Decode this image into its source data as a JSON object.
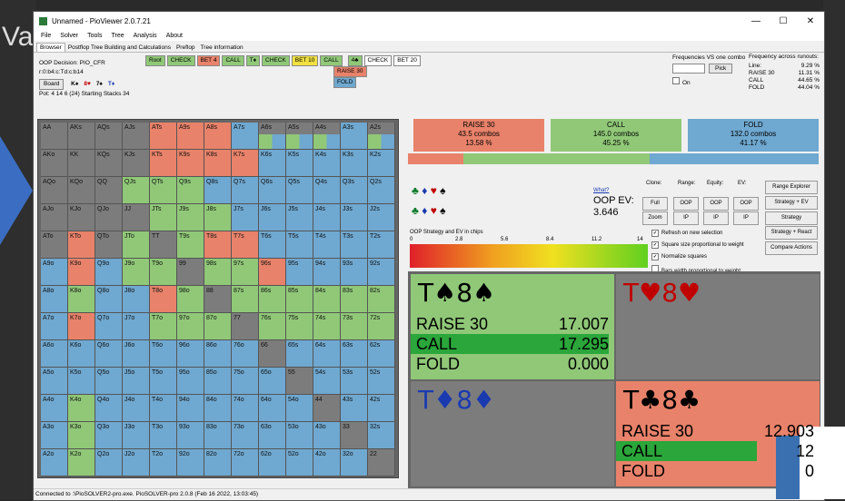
{
  "window": {
    "title": "Unnamed - PioViewer 2.0.7.21"
  },
  "background": {
    "left_text": "Va"
  },
  "menu": [
    "File",
    "Solver",
    "Tools",
    "Tree",
    "Analysis",
    "About"
  ],
  "tabs": [
    "Browser",
    "Postflop Tree Building and Calculations",
    "Preflop",
    "Tree information"
  ],
  "info": {
    "decision": "OOP Decision:   PIO_CFR",
    "line": "r:0:b4:c:Td:c:b14",
    "board_label": "Board",
    "board_cards": [
      "K♠",
      "8♥",
      "7♠",
      "T♦"
    ],
    "pot": "Pot: 4 14 6 (24) Starting Stacks 34"
  },
  "path": [
    {
      "label": "Root",
      "color": "#90c878"
    },
    {
      "label": "CHECK",
      "color": "#90c878"
    },
    {
      "label": "BET 4",
      "color": "#e8826a"
    },
    {
      "label": "CALL",
      "color": "#90c878"
    },
    {
      "label": "T♦",
      "color": "#90c878"
    },
    {
      "label": "CHECK",
      "color": "#90c878"
    },
    {
      "label": "BET 10",
      "color": "#f0e040"
    },
    {
      "label": "CALL",
      "color": "#90c878"
    },
    {
      "label": "4♣",
      "color": "#90c878"
    },
    {
      "label": "CHECK",
      "color": "#ffffff"
    },
    {
      "label": "BET 20",
      "color": "#ffffff"
    }
  ],
  "options": [
    {
      "label": "RAISE 30",
      "color": "#e8826a"
    },
    {
      "label": "FOLD",
      "color": "#6fa8d0"
    }
  ],
  "freq_vs_combo": {
    "title": "Frequencies VS one combo",
    "pick_label": "Pick",
    "on_label": "On"
  },
  "freq_runouts": {
    "title": "Frequency across runouts:",
    "rows": [
      {
        "k": "Line:",
        "v": "9.29 %"
      },
      {
        "k": "",
        "v": ""
      },
      {
        "k": "RAISE 30",
        "v": "11.31 %"
      },
      {
        "k": "CALL",
        "v": "44.65 %"
      },
      {
        "k": "FOLD",
        "v": "44.04 %"
      }
    ]
  },
  "summary": [
    {
      "action": "RAISE 30",
      "combos": "43.5 combos",
      "pct": "13.58 %",
      "color": "#e8826a"
    },
    {
      "action": "CALL",
      "combos": "145.0 combos",
      "pct": "45.25 %",
      "color": "#90c878"
    },
    {
      "action": "FOLD",
      "combos": "132.0 combos",
      "pct": "41.17 %",
      "color": "#6fa8d0"
    }
  ],
  "summary_bar": [
    0.1358,
    0.4525,
    0.4117
  ],
  "ev": {
    "what_label": "What?",
    "label": "OOP EV:",
    "value": "3.646"
  },
  "controls": {
    "clone": "Clone:",
    "range": "Range:",
    "equity": "Equity:",
    "ev": "EV:",
    "full": "Full",
    "zoom": "Zoom",
    "oop": "OOP",
    "ip": "IP",
    "range_explorer": "Range Explorer",
    "strategy_ev": "Strategy + EV",
    "strategy": "Strategy",
    "strategy_react": "Strategy + React",
    "compare_actions": "Compare Actions",
    "chart_title": "OOP Strategy and EV in chips",
    "ticks": [
      "0",
      "2.8",
      "5.6",
      "8.4",
      "11.2",
      "14"
    ],
    "checks": [
      {
        "label": "Refresh on new selection",
        "on": true
      },
      {
        "label": "Square size proportional to weight",
        "on": true
      },
      {
        "label": "Normalize squares",
        "on": true
      },
      {
        "label": "Bars width proportional to weight",
        "on": false
      }
    ]
  },
  "quads": [
    {
      "hand": [
        "T♠",
        "8♠"
      ],
      "suit_color": "#000",
      "bg": "#90c878",
      "rows": [
        {
          "name": "RAISE 30",
          "val": "17.007"
        },
        {
          "name": "CALL",
          "val": "17.295"
        },
        {
          "name": "FOLD",
          "val": "0.000"
        }
      ],
      "freq": [
        0,
        1.0,
        0
      ]
    },
    {
      "hand": [
        "T♥",
        "8♥"
      ],
      "suit_color": "#c00000",
      "bg": "#7c7c7c",
      "rows": [],
      "freq": []
    },
    {
      "hand": [
        "T♦",
        "8♦"
      ],
      "suit_color": "#1a3ab0",
      "bg": "#7c7c7c",
      "rows": [],
      "freq": []
    },
    {
      "hand": [
        "T♣",
        "8♣"
      ],
      "suit_color": "#000",
      "bg": "#e8826a",
      "rows": [
        {
          "name": "RAISE 30",
          "val": "12.903"
        },
        {
          "name": "CALL",
          "val": "12"
        },
        {
          "name": "FOLD",
          "val": "0"
        }
      ],
      "freq": [
        0,
        0.7,
        0
      ]
    }
  ],
  "status": "Connected to :\\PioSOLVER2-pro.exe. PioSOLVER-pro 2.0.8 (Feb 16 2022, 13:03:45)",
  "matrix": {
    "ranks": [
      "A",
      "K",
      "Q",
      "J",
      "T",
      "9",
      "8",
      "7",
      "6",
      "5",
      "4",
      "3",
      "2"
    ],
    "colors": {
      "raise": "#e8826a",
      "call": "#90c878",
      "fold": "#6fa8d0",
      "empty": "#7c7c7c"
    },
    "dominant": [
      [
        "e",
        "e",
        "e",
        "e",
        "r",
        "r",
        "r",
        "f",
        "m",
        "m",
        "m",
        "f",
        "m"
      ],
      [
        "e",
        "e",
        "e",
        "e",
        "r",
        "r",
        "r",
        "r",
        "f",
        "f",
        "f",
        "f",
        "f"
      ],
      [
        "e",
        "e",
        "e",
        "c",
        "c",
        "c",
        "f",
        "f",
        "f",
        "f",
        "f",
        "f",
        "f"
      ],
      [
        "e",
        "e",
        "e",
        "e",
        "c",
        "c",
        "c",
        "f",
        "f",
        "f",
        "f",
        "f",
        "f"
      ],
      [
        "e",
        "r",
        "e",
        "c",
        "e",
        "c",
        "r",
        "r",
        "f",
        "f",
        "f",
        "f",
        "f"
      ],
      [
        "f",
        "r",
        "f",
        "c",
        "c",
        "e",
        "c",
        "c",
        "r",
        "f",
        "f",
        "f",
        "f"
      ],
      [
        "f",
        "c",
        "f",
        "f",
        "r",
        "c",
        "e",
        "c",
        "c",
        "c",
        "c",
        "c",
        "c"
      ],
      [
        "f",
        "r",
        "f",
        "f",
        "c",
        "c",
        "c",
        "e",
        "c",
        "c",
        "c",
        "c",
        "c"
      ],
      [
        "f",
        "f",
        "f",
        "f",
        "f",
        "f",
        "f",
        "f",
        "e",
        "f",
        "f",
        "f",
        "f"
      ],
      [
        "f",
        "f",
        "f",
        "f",
        "f",
        "f",
        "f",
        "f",
        "f",
        "e",
        "f",
        "f",
        "f"
      ],
      [
        "f",
        "c",
        "f",
        "f",
        "f",
        "f",
        "f",
        "f",
        "f",
        "f",
        "e",
        "f",
        "f"
      ],
      [
        "f",
        "c",
        "f",
        "f",
        "f",
        "f",
        "f",
        "f",
        "f",
        "f",
        "f",
        "e",
        "f"
      ],
      [
        "f",
        "c",
        "f",
        "f",
        "f",
        "f",
        "f",
        "f",
        "f",
        "f",
        "f",
        "f",
        "e"
      ]
    ]
  }
}
